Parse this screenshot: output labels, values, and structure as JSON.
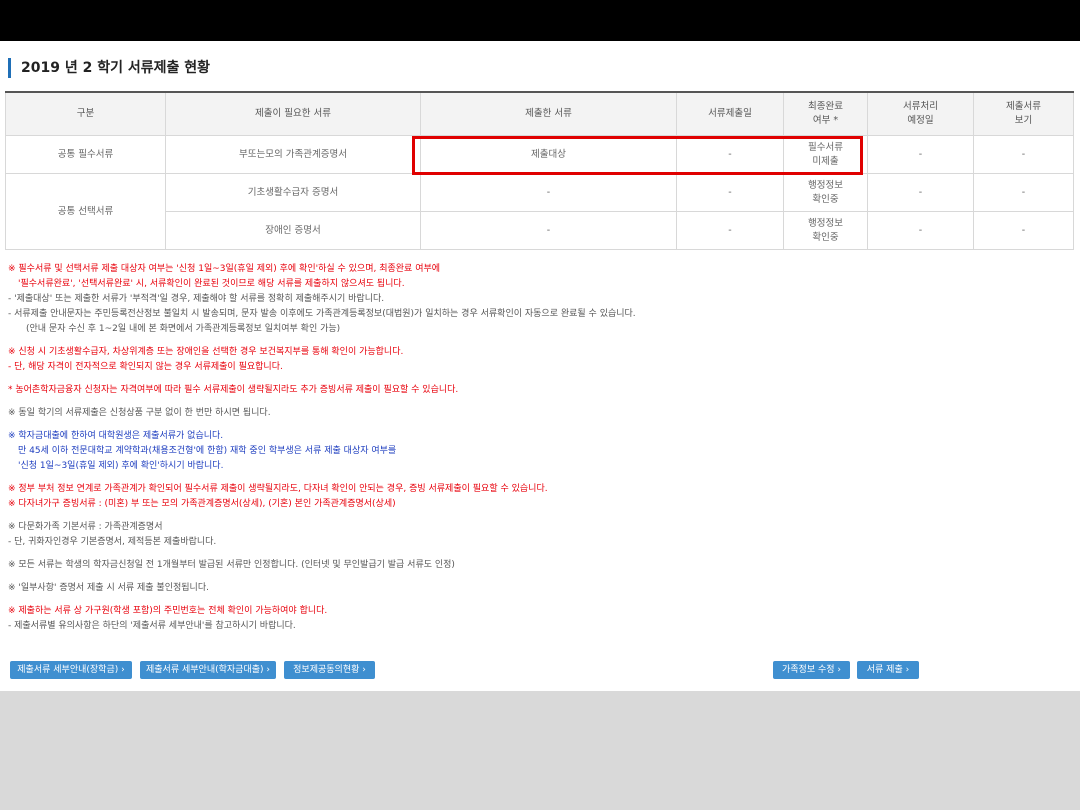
{
  "title": "2019 년 2 학기 서류제출 현황",
  "table": {
    "headers": [
      "구분",
      "제출이 필요한 서류",
      "제출한 서류",
      "서류제출일",
      "최종완료\n여부 *",
      "서류처리\n예정일",
      "제출서류\n보기"
    ],
    "rows": [
      {
        "category": "공통 필수서류",
        "doc": "부또는모의 가족관계증명서",
        "submitted": "제출대상",
        "date": "-",
        "status": "필수서류\n미제출",
        "expected": "-",
        "view": "-"
      },
      {
        "category": "공통 선택서류",
        "doc": "기초생활수급자 증명서",
        "submitted": "-",
        "date": "-",
        "status": "행정정보\n확인중",
        "expected": "-",
        "view": "-"
      },
      {
        "category": "",
        "doc": "장애인 증명서",
        "submitted": "-",
        "date": "-",
        "status": "행정정보\n확인중",
        "expected": "-",
        "view": "-"
      }
    ]
  },
  "notes": {
    "n1": "※ 필수서류 및 선택서류 제출 대상자 여부는 '신청 1일~3일(휴일 제외) 후에 확인'하실 수 있으며, 최종완료 여부에",
    "n2": "'필수서류완료', '선택서류완료' 시, 서류확인이 완료된 것이므로 해당 서류를 제출하지 않으셔도 됩니다.",
    "n3": "- '제출대상' 또는 제출한 서류가 '부적격'일 경우, 제출해야 할 서류를 정확히 제출해주시기 바랍니다.",
    "n4": "- 서류제출 안내문자는 주민등록전산정보 불일치 시 발송되며, 문자 발송 이후에도 가족관계등록정보(대법원)가 일치하는 경우 서류확인이 자동으로 완료될 수 있습니다.",
    "n5": "(안내 문자 수신 후 1~2일 내에 본 화면에서 가족관계등록정보 일치여부 확인 가능)",
    "n6": "※ 신청 시 기초생활수급자, 차상위계층 또는 장애인을 선택한 경우 보건복지부를 통해 확인이 가능합니다.",
    "n7": "- 단, 해당 자격이 전자적으로 확인되지 않는 경우 서류제출이 필요합니다.",
    "n8": "* 농어촌학자금융자 신청자는 자격여부에 따라 필수 서류제출이 생략될지라도 추가 증빙서류 제출이 필요할 수 있습니다.",
    "n9": "※ 동일 학기의 서류제출은 신청상품 구분 없이 한 번만 하시면 됩니다.",
    "n10": "※ 학자금대출에 한하여 대학원생은 제출서류가 없습니다.",
    "n11": "만 45세 이하 전문대학교 계약학과(채용조건형'에 한함) 재학 중인 학부생은 서류 제출 대상자 여부를",
    "n12": "'신청 1일~3일(휴일 제외) 후에 확인'하시기 바랍니다.",
    "n13": "※ 정부 부처 정보 연계로 가족관계가 확인되어 필수서류 제출이 생략될지라도, 다자녀 확인이 안되는 경우, 증빙 서류제출이 필요할 수 있습니다.",
    "n14": "※ 다자녀가구 증빙서류 : (미혼) 부 또는 모의 가족관계증명서(상세), (기혼) 본인 가족관계증명서(상세)",
    "n15": "※ 다문화가족 기본서류 : 가족관계증명서",
    "n16": "- 단, 귀화자인경우 기본증명서, 제적등본 제출바랍니다.",
    "n17": "※ 모든 서류는 학생의 학자금신청일 전 1개월부터 발급된 서류만 인정합니다. (인터넷 및 무인발급기 발급 서류도 인정)",
    "n18": "※ '일부사항' 증명서 제출 시 서류 제출 불인정됩니다.",
    "n19": "※ 제출하는 서류 상 가구원(학생 포함)의 주민번호는 전체 확인이 가능하여야 합니다.",
    "n20": "- 제출서류별 유의사항은 하단의 '제출서류 세부안내'를 참고하시기 바랍니다."
  },
  "buttons": {
    "guide_scholarship": "제출서류 세부안내(장학금) ›",
    "guide_loan": "제출서류 세부안내(학자금대출) ›",
    "info_sharing": "정보제공동의현황 ›",
    "edit_family": "가족정보 수정 ›",
    "submit_docs": "서류 제출 ›"
  },
  "colors": {
    "accent": "#3f8fd0",
    "highlight": "#e00000",
    "warning_text": "#e8000b",
    "info_text": "#1d3dbf"
  }
}
